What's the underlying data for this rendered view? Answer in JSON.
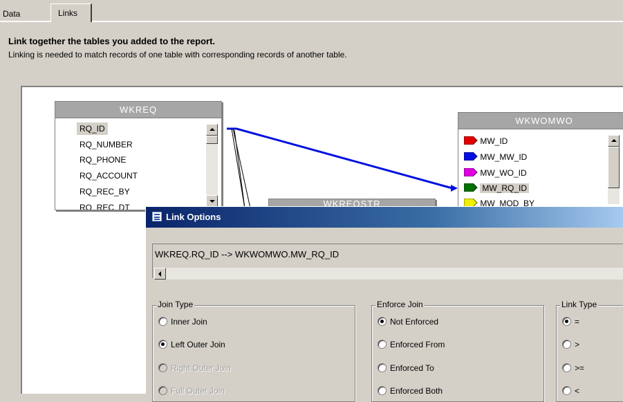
{
  "tabs": [
    {
      "label": "Data",
      "active": false
    },
    {
      "label": "Links",
      "active": true
    }
  ],
  "heading": "Link together the tables you added to the report.",
  "subheading": "Linking is needed to match records of one table with corresponding records of another table.",
  "tables": {
    "wkreq": {
      "title": "WKREQ",
      "fields": [
        "RQ_ID",
        "RQ_NUMBER",
        "RQ_PHONE",
        "RQ_ACCOUNT",
        "RQ_REC_BY",
        "RQ_REC_DT"
      ],
      "selected": "RQ_ID"
    },
    "wkwomwo": {
      "title": "WKWOMWO",
      "fields": [
        {
          "name": "MW_ID",
          "key_color": "#e00000"
        },
        {
          "name": "MW_MW_ID",
          "key_color": "#0010e0"
        },
        {
          "name": "MW_WO_ID",
          "key_color": "#e000e0"
        },
        {
          "name": "MW_RQ_ID",
          "key_color": "#007000"
        },
        {
          "name": "MW_MOD_BY",
          "key_color": "#f0f000"
        }
      ],
      "selected": "MW_RQ_ID"
    },
    "wkreqstr": {
      "title": "WKREQSTR"
    }
  },
  "link_color": "#0010e0",
  "dialog": {
    "title": "Link Options",
    "link_expression": "WKREQ.RQ_ID --> WKWOMWO.MW_RQ_ID",
    "join_type": {
      "label": "Join Type",
      "options": [
        {
          "label": "Inner Join",
          "selected": false,
          "enabled": true
        },
        {
          "label": "Left Outer Join",
          "selected": true,
          "enabled": true
        },
        {
          "label": "Right Outer Join",
          "selected": false,
          "enabled": false
        },
        {
          "label": "Full Outer Join",
          "selected": false,
          "enabled": false
        }
      ]
    },
    "enforce_join": {
      "label": "Enforce Join",
      "options": [
        {
          "label": "Not Enforced",
          "selected": true,
          "enabled": true
        },
        {
          "label": "Enforced From",
          "selected": false,
          "enabled": true
        },
        {
          "label": "Enforced To",
          "selected": false,
          "enabled": true
        },
        {
          "label": "Enforced Both",
          "selected": false,
          "enabled": true
        }
      ]
    },
    "link_type": {
      "label": "Link Type",
      "options": [
        {
          "label": "=",
          "selected": true,
          "enabled": true
        },
        {
          "label": ">",
          "selected": false,
          "enabled": true
        },
        {
          "label": ">=",
          "selected": false,
          "enabled": true
        },
        {
          "label": "<",
          "selected": false,
          "enabled": true
        }
      ]
    }
  }
}
